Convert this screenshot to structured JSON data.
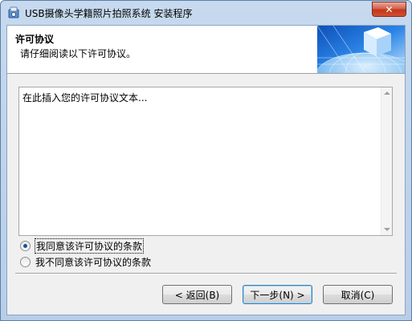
{
  "window": {
    "title": "USB摄像头学籍照片拍照系统 安装程序",
    "close_glyph": "✕"
  },
  "header": {
    "title": "许可协议",
    "subtitle": "请仔细阅读以下许可协议。"
  },
  "license": {
    "text": "在此插入您的许可协议文本..."
  },
  "options": {
    "accept_label": "我同意该许可协议的条款",
    "decline_label": "我不同意该许可协议的条款",
    "selected": "accept"
  },
  "buttons": {
    "back_label": "< 返回(B)",
    "next_label": "下一步(N) >",
    "cancel_label": "取消(C)"
  },
  "colors": {
    "title_bar": "#c6d9ee",
    "close_button": "#c2371d",
    "header_graphic_sky": "#1f6fcf"
  }
}
